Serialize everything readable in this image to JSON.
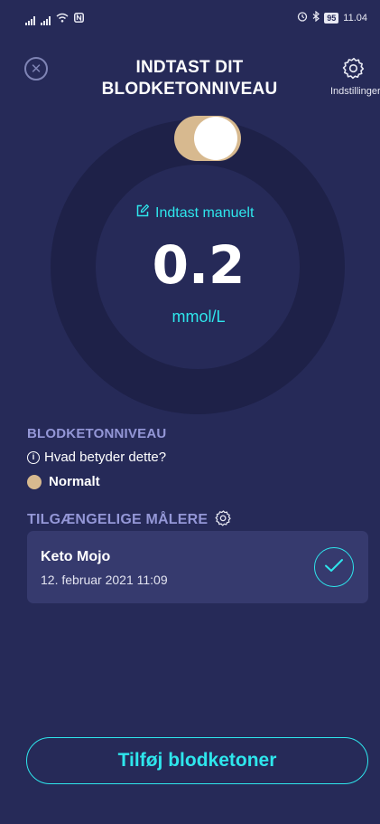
{
  "status_bar": {
    "battery": "95",
    "time": "11.04"
  },
  "header": {
    "title": "INDTAST DIT BLODKETONNIVEAU",
    "settings_label": "Indstillinger",
    "close_icon": "close-icon",
    "settings_icon": "gear-icon"
  },
  "reading": {
    "manual_entry_label": "Indtast manuelt",
    "value": "0.2",
    "unit": "mmol/L",
    "toggle_on": true
  },
  "level": {
    "heading": "BLODKETONNIVEAU",
    "info_label": "Hvad betyder dette?",
    "status": "Normalt",
    "status_color": "#d7b98f"
  },
  "meters": {
    "heading": "TILGÆNGELIGE MÅLERE",
    "items": [
      {
        "name": "Keto Mojo",
        "date": "12. februar 2021 11:09",
        "selected": true
      }
    ]
  },
  "actions": {
    "add_label": "Tilføj blodketoner"
  },
  "colors": {
    "background": "#262a58",
    "accent": "#2ee6ec",
    "heading": "#9497d7",
    "toggle": "#d7b98f"
  }
}
